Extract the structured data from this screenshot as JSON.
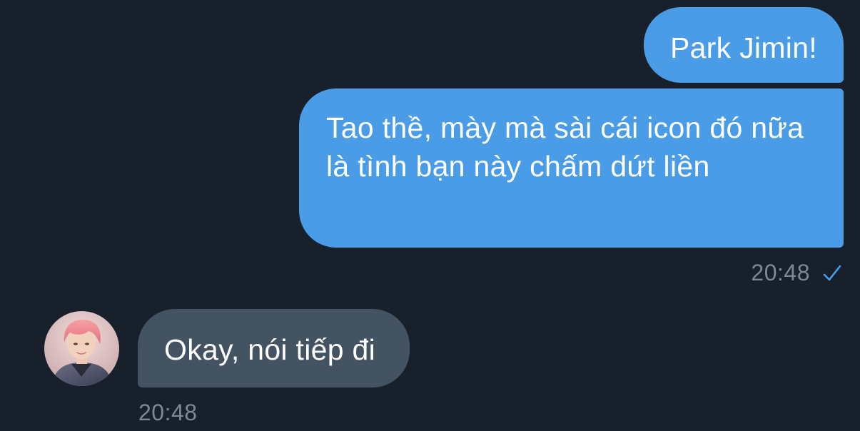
{
  "conversation": {
    "outgoing": [
      {
        "text": "Park Jimin!"
      },
      {
        "text": "Tao thề, mày mà sài cái icon đó nữa là tình bạn này chấm dứt liền"
      }
    ],
    "outgoing_time": "20:48",
    "outgoing_status_icon": "single-check-icon",
    "incoming": [
      {
        "text": "Okay, nói tiếp đi"
      }
    ],
    "incoming_time": "20:48",
    "incoming_avatar_icon": "contact-avatar"
  },
  "colors": {
    "background": "#18202b",
    "outgoing_bubble": "#4b9ce7",
    "incoming_bubble": "#435362",
    "timestamp": "#7c8896",
    "check_mark": "#4b9ce7"
  }
}
